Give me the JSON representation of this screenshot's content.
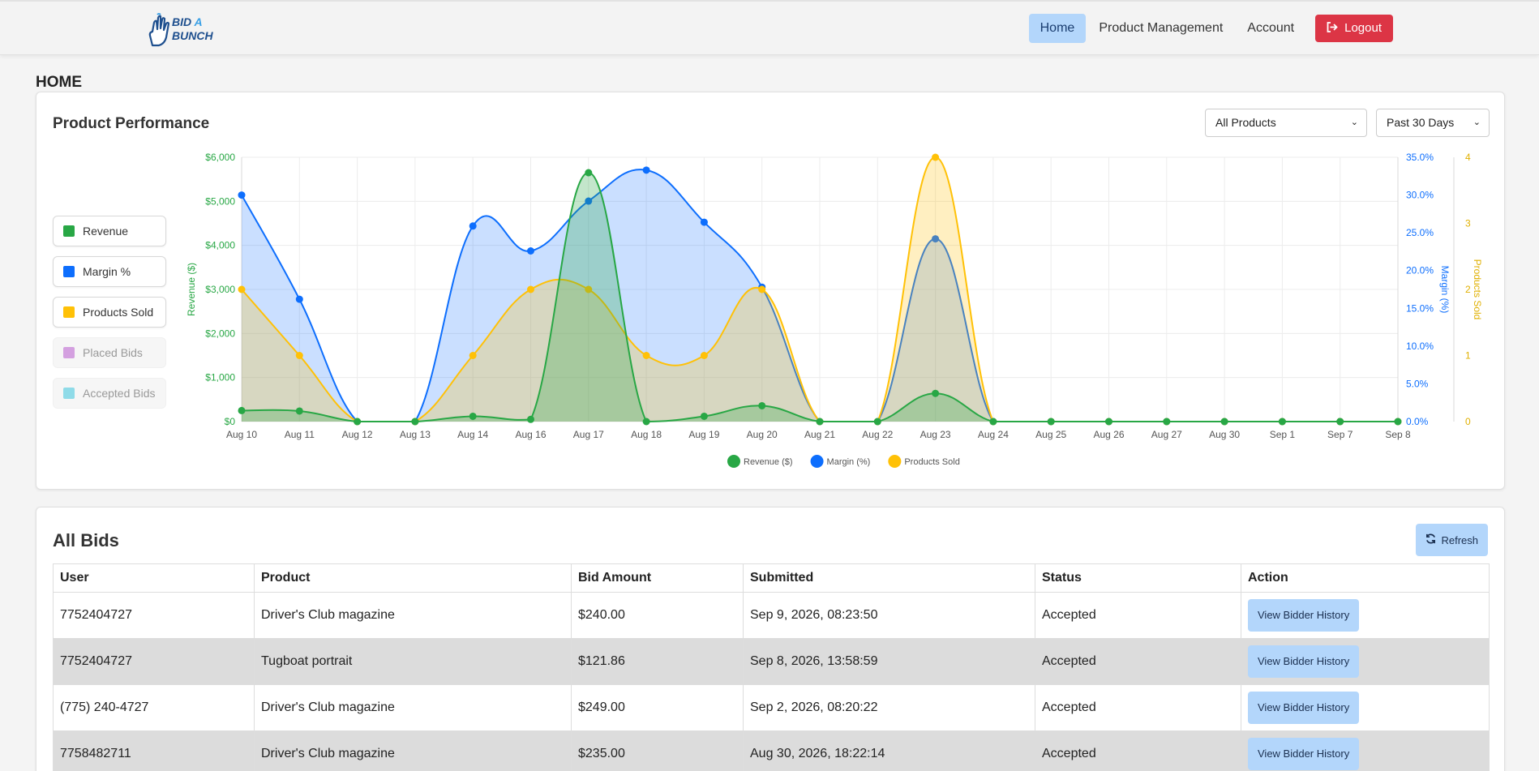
{
  "navbar": {
    "logo_line1": "BID",
    "logo_a": "A",
    "logo_line2": "BUNCH",
    "links": [
      "Home",
      "Product Management",
      "Account"
    ],
    "logout_label": "Logout"
  },
  "page_title": "HOME",
  "performance": {
    "title": "Product Performance",
    "product_filter": "All Products",
    "period_filter": "Past 30 Days",
    "toggles": [
      {
        "label": "Revenue",
        "color": "#28a745",
        "active": true
      },
      {
        "label": "Margin %",
        "color": "#0d6efd",
        "active": true
      },
      {
        "label": "Products Sold",
        "color": "#ffc107",
        "active": true
      },
      {
        "label": "Placed Bids",
        "color": "#d4a0e0",
        "active": false
      },
      {
        "label": "Accepted Bids",
        "color": "#8fdbe8",
        "active": false
      }
    ]
  },
  "chart_data": {
    "type": "area",
    "x": [
      "Aug 10",
      "Aug 11",
      "Aug 12",
      "Aug 13",
      "Aug 14",
      "Aug 16",
      "Aug 17",
      "Aug 18",
      "Aug 19",
      "Aug 20",
      "Aug 21",
      "Aug 22",
      "Aug 23",
      "Aug 24",
      "Aug 25",
      "Aug 26",
      "Aug 27",
      "Aug 30",
      "Sep 1",
      "Sep 7",
      "Sep 8"
    ],
    "series": [
      {
        "name": "Revenue ($)",
        "axis": "left",
        "color": "#28a745",
        "values": [
          250,
          240,
          0,
          0,
          120,
          50,
          5650,
          0,
          120,
          360,
          0,
          0,
          640,
          0,
          0,
          0,
          0,
          0,
          0,
          0,
          0
        ]
      },
      {
        "name": "Margin (%)",
        "axis": "right1",
        "color": "#0d6efd",
        "values": [
          30.0,
          16.2,
          0,
          0,
          25.9,
          22.6,
          29.2,
          33.3,
          26.4,
          17.8,
          0,
          0,
          24.2,
          0,
          0,
          0,
          0,
          0,
          0,
          0,
          0
        ]
      },
      {
        "name": "Products Sold",
        "axis": "right2",
        "color": "#ffc107",
        "values": [
          2,
          1,
          0,
          0,
          1,
          2,
          2,
          1,
          1,
          2,
          0,
          0,
          4,
          0,
          0,
          0,
          0,
          0,
          0,
          0,
          0
        ]
      }
    ],
    "axes": {
      "left": {
        "label": "Revenue ($)",
        "ylim": [
          0,
          6000
        ],
        "ticks": [
          "$0",
          "$1,000",
          "$2,000",
          "$3,000",
          "$4,000",
          "$5,000",
          "$6,000"
        ],
        "color": "#28a745"
      },
      "right1": {
        "label": "Margin (%)",
        "ylim": [
          0,
          35
        ],
        "ticks": [
          "0.0%",
          "5.0%",
          "10.0%",
          "15.0%",
          "20.0%",
          "25.0%",
          "30.0%",
          "35.0%"
        ],
        "color": "#0d6efd"
      },
      "right2": {
        "label": "Products Sold",
        "ylim": [
          0,
          4
        ],
        "ticks": [
          "0",
          "1",
          "2",
          "3",
          "4"
        ],
        "color": "#e0b000"
      }
    },
    "grid": true,
    "legend": "bottom-center"
  },
  "bids": {
    "title": "All Bids",
    "refresh_label": "Refresh",
    "columns": [
      "User",
      "Product",
      "Bid Amount",
      "Submitted",
      "Status",
      "Action"
    ],
    "rows": [
      {
        "user": "7752404727",
        "product": "Driver's Club magazine",
        "amount": "$240.00",
        "submitted": "Sep 9, 2026, 08:23:50",
        "status": "Accepted",
        "action": "View Bidder History"
      },
      {
        "user": "7752404727",
        "product": "Tugboat portrait",
        "amount": "$121.86",
        "submitted": "Sep 8, 2026, 13:58:59",
        "status": "Accepted",
        "action": "View Bidder History"
      },
      {
        "user": "(775) 240-4727",
        "product": "Driver's Club magazine",
        "amount": "$249.00",
        "submitted": "Sep 2, 2026, 08:20:22",
        "status": "Accepted",
        "action": "View Bidder History"
      },
      {
        "user": "7758482711",
        "product": "Driver's Club magazine",
        "amount": "$235.00",
        "submitted": "Aug 30, 2026, 18:22:14",
        "status": "Accepted",
        "action": "View Bidder History"
      }
    ]
  }
}
